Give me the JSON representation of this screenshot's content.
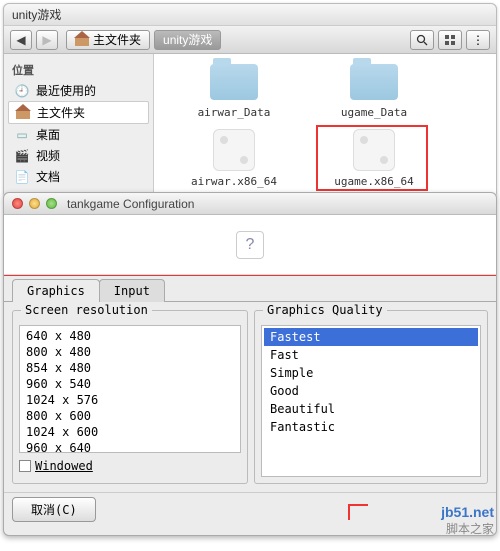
{
  "fm": {
    "title": "unity游戏",
    "crumb_home": "主文件夹",
    "crumb_current": "unity游戏",
    "sidebar_head": "位置",
    "sidebar": [
      {
        "label": "最近使用的"
      },
      {
        "label": "主文件夹"
      },
      {
        "label": "桌面"
      },
      {
        "label": "视频"
      },
      {
        "label": "文档"
      }
    ],
    "items": [
      {
        "name": "airwar_Data"
      },
      {
        "name": "ugame_Data"
      },
      {
        "name": "airwar.x86_64"
      },
      {
        "name": "ugame.x86_64"
      }
    ]
  },
  "cfg": {
    "title": "tankgame Configuration",
    "banner_icon": "?",
    "tabs": {
      "graphics": "Graphics",
      "input": "Input"
    },
    "res_label": "Screen resolution",
    "resolutions": [
      "640 x 480",
      "800 x 480",
      "854 x 480",
      "960 x 540",
      "1024 x 576",
      "800 x 600",
      "1024 x 600",
      "960 x 640"
    ],
    "windowed": "Windowed",
    "quality_label": "Graphics Quality",
    "quality": [
      "Fastest",
      "Fast",
      "Simple",
      "Good",
      "Beautiful",
      "Fantastic"
    ],
    "quality_selected": 0,
    "cancel": "取消(C)"
  },
  "watermark": {
    "line1": "jb51.net",
    "line2": "脚本之家"
  }
}
